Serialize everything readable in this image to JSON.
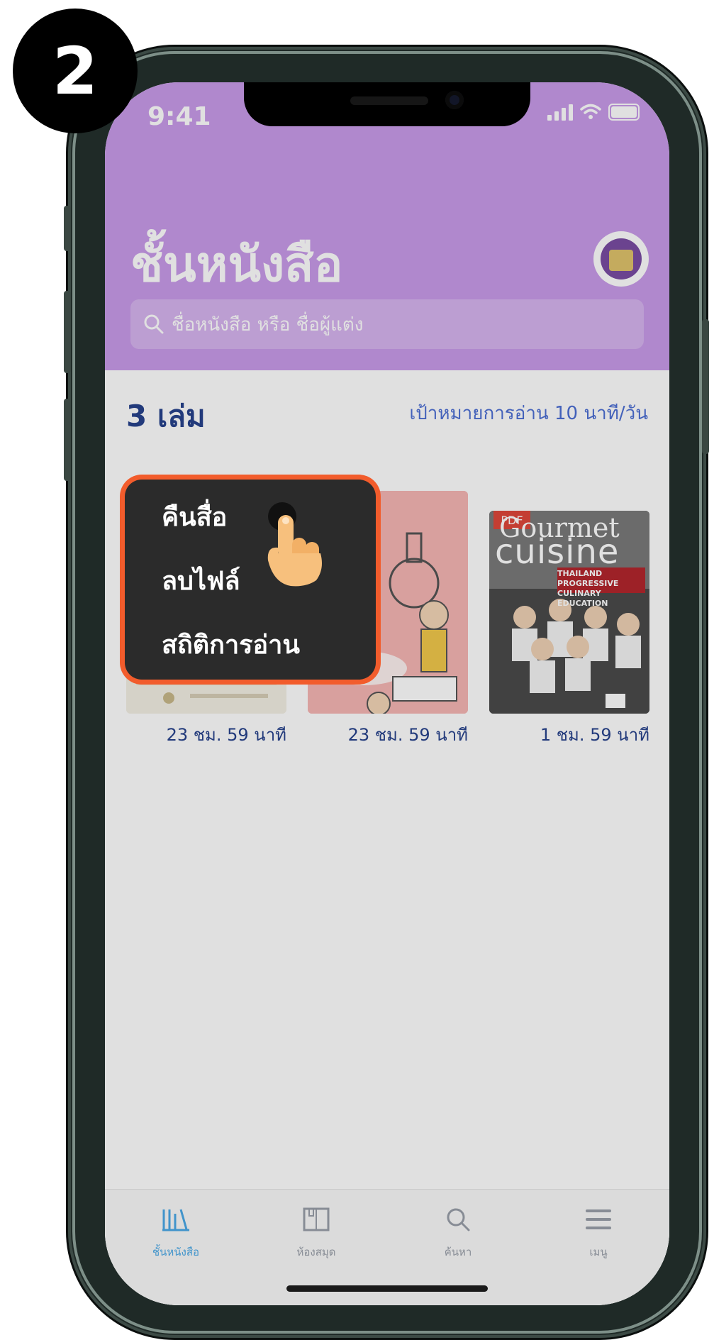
{
  "step": {
    "number": "2"
  },
  "status_bar": {
    "time": "9:41"
  },
  "header": {
    "title": "ชั้นหนังสือ",
    "search_placeholder": "ชื่อหนังสือ หรือ ชื่อผู้แต่ง"
  },
  "shelf": {
    "count_label": "3 เล่ม",
    "reading_goal": "เป้าหมายการอ่าน 10 นาที/วัน",
    "books": [
      {
        "time_left": "23 ชม. 59 นาที"
      },
      {
        "time_left": "23 ชม. 59 นาที"
      },
      {
        "time_left": "1 ชม. 59 นาที",
        "badge": "PDF",
        "cover_title_1": "Gourmet",
        "cover_title_2": "cuisine",
        "cover_subtitle": "THAILAND PROGRESSIVE CULINARY EDUCATION"
      }
    ]
  },
  "context_menu": {
    "items": [
      {
        "label": "คืนสื่อ"
      },
      {
        "label": "ลบไฟล์"
      },
      {
        "label": "สถิติการอ่าน"
      }
    ]
  },
  "tabbar": {
    "tabs": [
      {
        "label": "ชั้นหนังสือ",
        "icon": "bookshelf-icon",
        "active": true
      },
      {
        "label": "ห้องสมุด",
        "icon": "library-icon",
        "active": false
      },
      {
        "label": "ค้นหา",
        "icon": "search-icon",
        "active": false
      },
      {
        "label": "เมนู",
        "icon": "menu-icon",
        "active": false
      }
    ]
  },
  "colors": {
    "header": "#c99bea",
    "accent_text": "#27428d",
    "goal_text": "#4d6fd4",
    "highlight": "#f25c2c",
    "menu_bg": "#2b2b2b",
    "tab_active": "#4aa9e8"
  }
}
